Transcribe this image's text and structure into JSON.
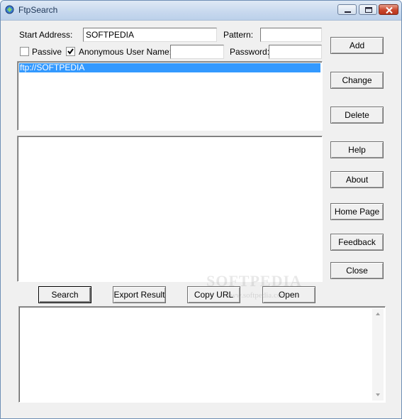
{
  "window": {
    "title": "FtpSearch",
    "icon": "ftpsearch-app-icon",
    "controls": {
      "minimize": "minimize-icon",
      "maximize": "maximize-icon",
      "close": "close-icon"
    }
  },
  "form": {
    "start_address_label": "Start Address:",
    "start_address_value": "SOFTPEDIA",
    "pattern_label": "Pattern:",
    "pattern_value": "",
    "passive_label": "Passive",
    "passive_checked": false,
    "anonymous_label": "Anonymous",
    "anonymous_checked": true,
    "username_label": "User Name:",
    "username_value": "",
    "password_label": "Password:",
    "password_value": ""
  },
  "address_list": {
    "items": [
      "ftp://SOFTPEDIA"
    ],
    "selected_index": 0
  },
  "side_buttons": {
    "add": "Add",
    "change": "Change",
    "delete": "Delete",
    "help": "Help",
    "about": "About",
    "home_page": "Home Page",
    "feedback": "Feedback",
    "close": "Close"
  },
  "bottom_buttons": {
    "search": "Search",
    "export_result": "Export Result",
    "copy_url": "Copy URL",
    "open": "Open"
  },
  "watermark": {
    "text": "SOFTPEDIA",
    "url": "www.softpedia.com"
  },
  "colors": {
    "selection": "#3399ff",
    "window_bg": "#f0f0f0",
    "titlebar": "#c7d8ee"
  }
}
